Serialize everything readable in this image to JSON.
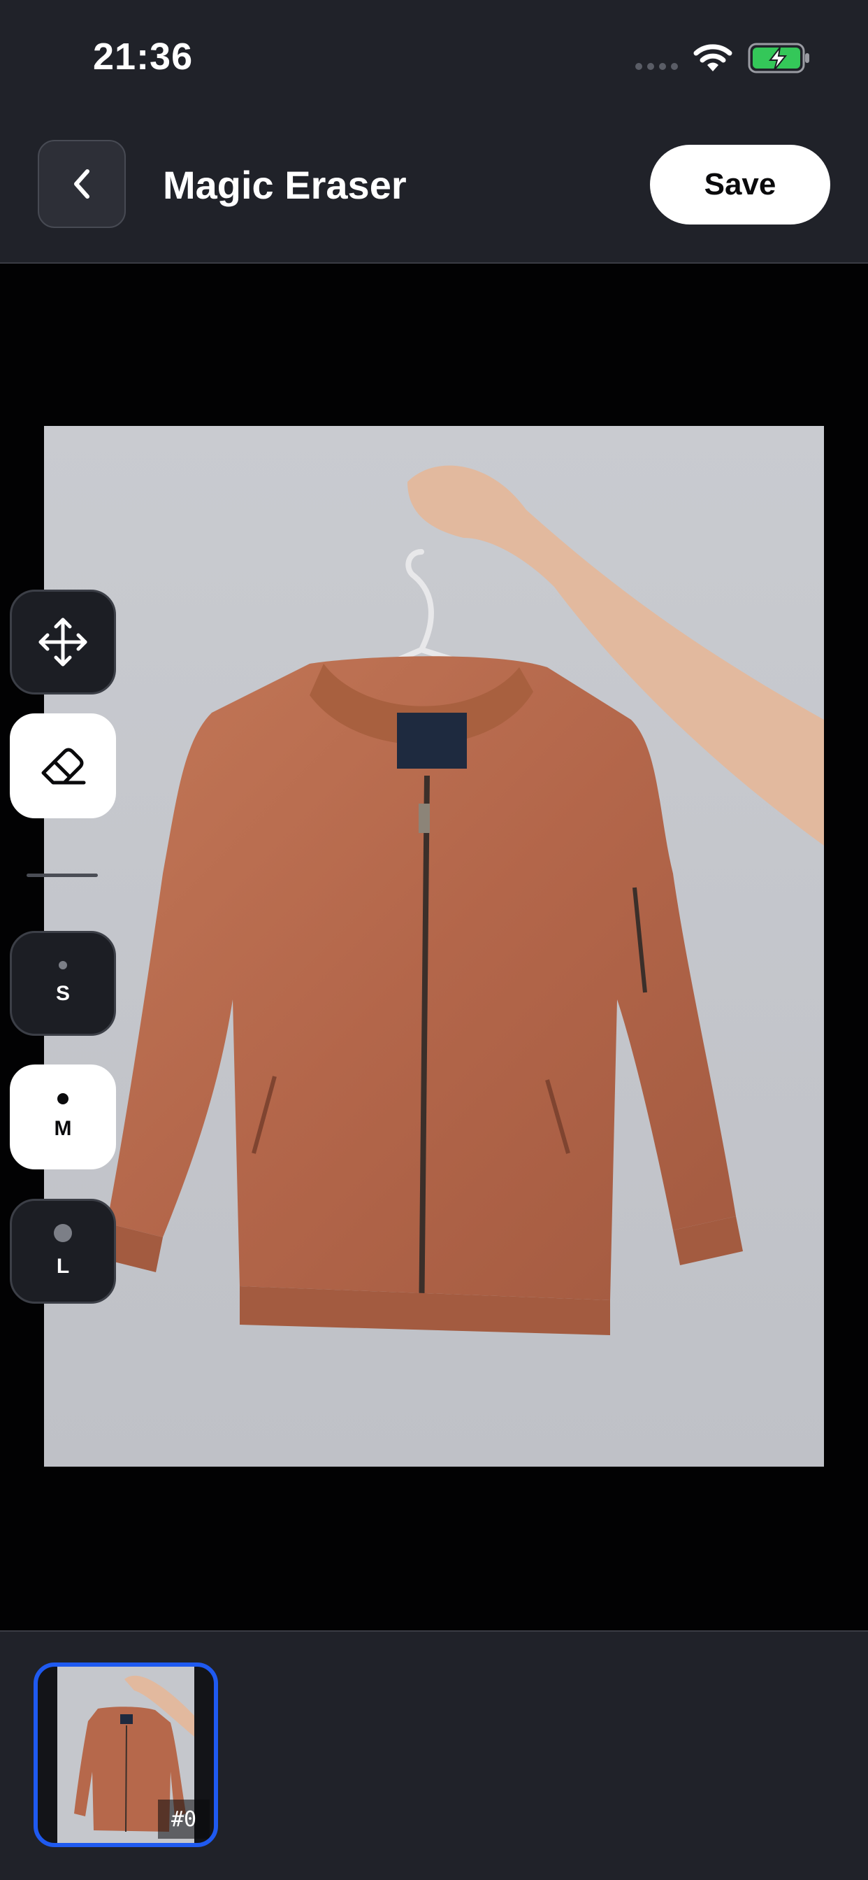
{
  "status_bar": {
    "time": "21:36",
    "icons": [
      "cellular-signal-icon",
      "wifi-icon",
      "battery-charging-icon"
    ],
    "battery_color": "#34c759"
  },
  "header": {
    "back_icon": "chevron-left-icon",
    "title": "Magic Eraser",
    "save_label": "Save"
  },
  "tools": {
    "move_icon": "move-arrows-icon",
    "eraser_icon": "eraser-icon",
    "active_tool": "eraser"
  },
  "brush_sizes": {
    "selected": "M",
    "options": [
      {
        "label": "S"
      },
      {
        "label": "M"
      },
      {
        "label": "L"
      }
    ]
  },
  "canvas": {
    "image_subject": "photo-of-jacket-on-hanger",
    "jacket_color": "#b8694d",
    "background_color": "#c5c7cc"
  },
  "thumbnails": {
    "selected_index": 0,
    "accent_color": "#1f5af0",
    "items": [
      {
        "badge": "#0"
      }
    ]
  }
}
